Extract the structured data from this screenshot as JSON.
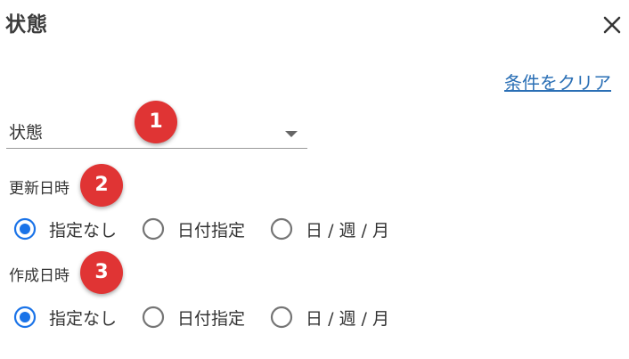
{
  "dialog": {
    "title": "状態",
    "clear_label": "条件をクリア"
  },
  "status_select": {
    "value": "状態"
  },
  "sections": [
    {
      "label": "更新日時",
      "selected": 0,
      "options": [
        "指定なし",
        "日付指定",
        "日 / 週 / 月"
      ]
    },
    {
      "label": "作成日時",
      "selected": 0,
      "options": [
        "指定なし",
        "日付指定",
        "日 / 週 / 月"
      ]
    }
  ],
  "badges": [
    "1",
    "2",
    "3"
  ],
  "colors": {
    "accent": "#1a73e8",
    "link": "#2a6fb5",
    "badge": "#e03434",
    "text": "#333333"
  }
}
